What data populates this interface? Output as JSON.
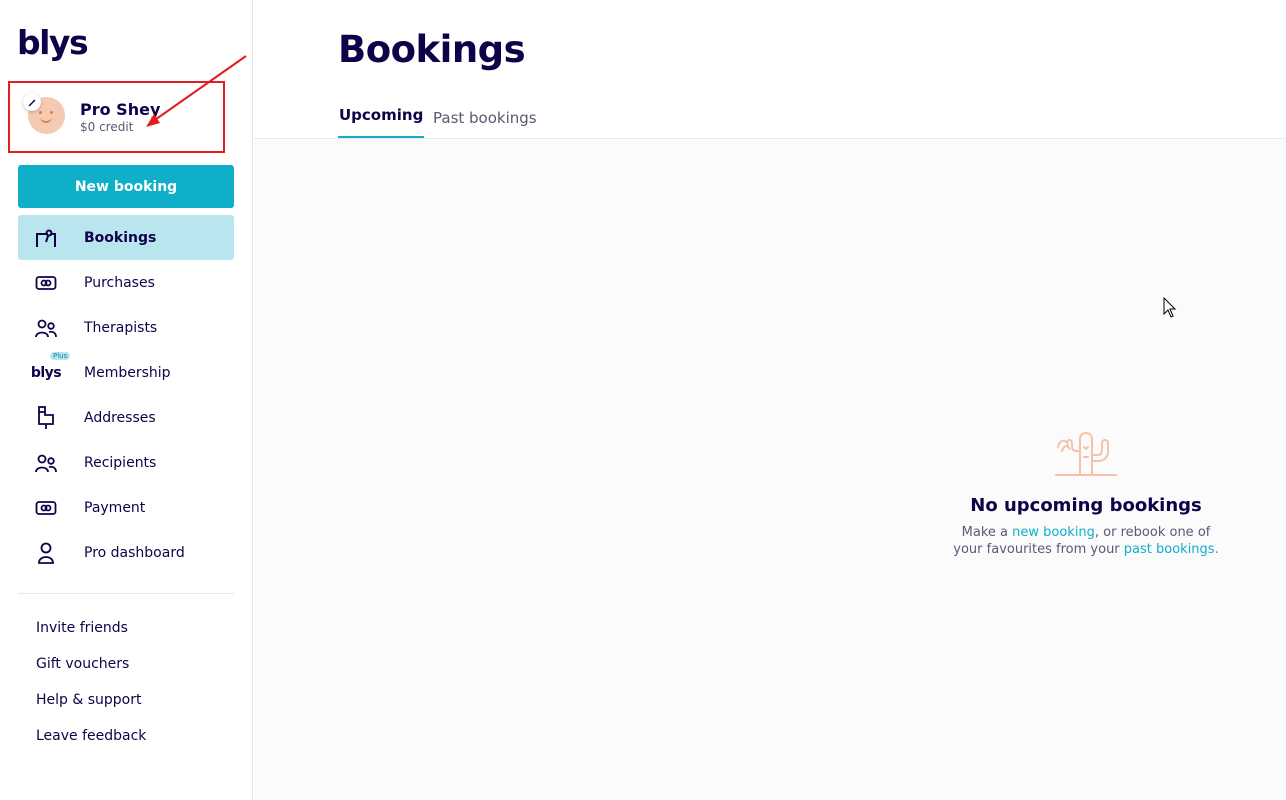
{
  "brand": {
    "logo": "blys",
    "accent": "#0fafca",
    "navy": "#100249"
  },
  "profile": {
    "name": "Pro Shey",
    "credit": "$0 credit"
  },
  "sidebar": {
    "new_booking": "New booking",
    "items": [
      {
        "label": "Bookings",
        "icon": "bookings-icon",
        "active": true
      },
      {
        "label": "Purchases",
        "icon": "ticket-icon"
      },
      {
        "label": "Therapists",
        "icon": "users-icon"
      },
      {
        "label": "Membership",
        "icon": "blys-plus-icon",
        "badge": "Plus",
        "logo": "blys"
      },
      {
        "label": "Addresses",
        "icon": "mailbox-icon"
      },
      {
        "label": "Recipients",
        "icon": "users-icon"
      },
      {
        "label": "Payment",
        "icon": "ticket-icon"
      },
      {
        "label": "Pro dashboard",
        "icon": "user-icon"
      }
    ],
    "footer": [
      "Invite friends",
      "Gift vouchers",
      "Help & support",
      "Leave feedback"
    ]
  },
  "main": {
    "title": "Bookings",
    "tabs": [
      {
        "label": "Upcoming",
        "active": true
      },
      {
        "label": "Past bookings",
        "active": false
      }
    ],
    "empty_state": {
      "icon": "cactus-icon",
      "title": "No upcoming bookings",
      "line1_prefix": "Make a ",
      "line1_link": "new booking",
      "line1_suffix": ", or rebook one of",
      "line2_prefix": "your favourites from your ",
      "line2_link": "past bookings."
    }
  }
}
